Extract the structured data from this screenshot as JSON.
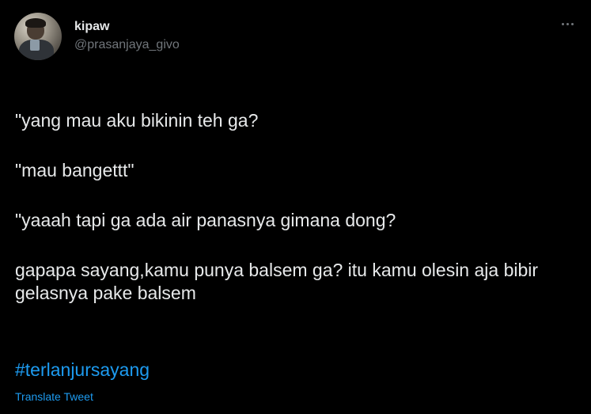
{
  "author": {
    "display_name": "kipaw",
    "handle": "@prasanjaya_givo",
    "avatar_icon": "profile-photo"
  },
  "menu": {
    "more_icon": "more-horizontal-icon"
  },
  "tweet": {
    "paragraphs": [
      "\"yang mau aku bikinin teh ga?",
      "\"mau bangettt\"",
      "\"yaaah tapi ga ada air panasnya gimana dong?",
      "gapapa sayang,kamu punya balsem ga? itu kamu olesin aja bibir gelasnya pake balsem"
    ],
    "hashtag": "#terlanjursayang",
    "translate_label": "Translate Tweet"
  },
  "colors": {
    "background": "#000000",
    "text": "#e7e9ea",
    "secondary_text": "#71767b",
    "link": "#1d9bf0"
  }
}
